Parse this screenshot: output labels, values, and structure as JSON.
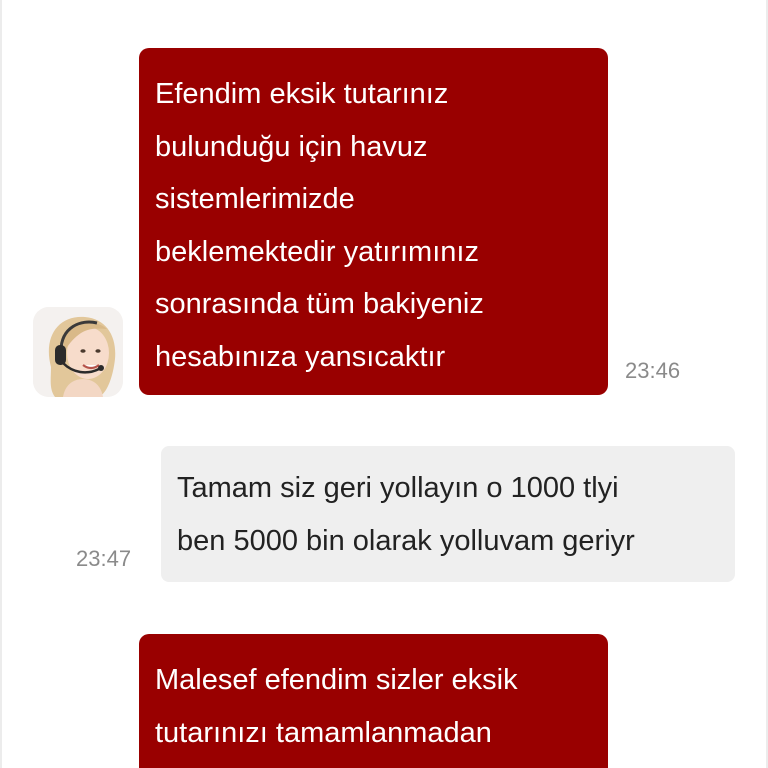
{
  "conversation": {
    "messages": [
      {
        "sender": "agent",
        "text": "Efendim eksik tutarınız\nbulunduğu için havuz\nsistemlerimizde\nbeklemektedir yatırımınız\nsonrasında tüm bakiyeniz\nhesabınıza yansıcaktır",
        "time": "23:46"
      },
      {
        "sender": "user",
        "text": "Tamam siz geri yollayın o 1000 tlyi\nben 5000 bin olarak yolluvam geriyr",
        "time": "23:47"
      },
      {
        "sender": "agent",
        "text": "Malesef efendim sizler eksik\ntutarınızı tamamlanmadan"
      }
    ]
  },
  "colors": {
    "agent_bubble": "#990000",
    "agent_text": "#ffffff",
    "user_bubble": "#efefef",
    "user_text": "#222222",
    "timestamp": "#8a8a8a"
  },
  "icons": {
    "agent_avatar": "support-agent-avatar"
  }
}
